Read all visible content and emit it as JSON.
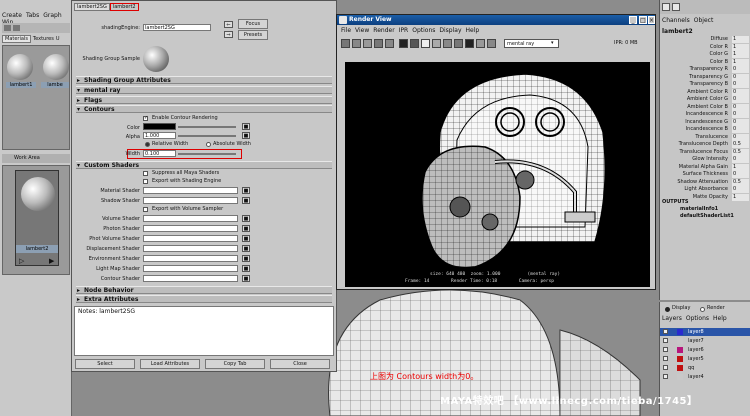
{
  "hypershade": {
    "menu": [
      "Create",
      "Tabs",
      "Graph",
      "Win"
    ],
    "tabs": [
      "Materials",
      "Textures",
      "U"
    ],
    "swatches": [
      "lambert1",
      "lambe"
    ],
    "work_area_label": "Work Area",
    "work_swatch": "lambert2"
  },
  "attr_editor": {
    "tabs": [
      "lambert2SG",
      "lambert2"
    ],
    "shading_engine_label": "shadingEngine:",
    "shading_engine_value": "lambert2SG",
    "focus_btn": "Focus",
    "presets_btn": "Presets",
    "sample_label": "Shading Group Sample",
    "sections": {
      "sg_attrs": "Shading Group Attributes",
      "mental_ray": "mental ray",
      "flags": "Flags",
      "contours": "Contours",
      "custom": "Custom Shaders",
      "node_behavior": "Node Behavior",
      "extra": "Extra Attributes"
    },
    "contours": {
      "enable": "Enable Contour Rendering",
      "color_label": "Color",
      "alpha_label": "Alpha",
      "alpha_value": "1.000",
      "relative": "Relative Width",
      "absolute": "Absolute Width",
      "width_label": "Width",
      "width_value": "0.100"
    },
    "custom": {
      "suppress": "Suppress all Maya Shaders",
      "export_engine": "Export with Shading Engine",
      "material": "Material Shader",
      "shadow": "Shadow Shader",
      "export_volume": "Export with Volume Sampler",
      "volume": "Volume Shader",
      "photon": "Photon Shader",
      "photon_vol": "Phot Volume Shader",
      "displacement": "Displacement Shader",
      "environment": "Environment Shader",
      "light_map": "Light Map Shader",
      "contour": "Contour Shader"
    },
    "notes": "Notes: lambert2SG",
    "buttons": [
      "Select",
      "Load Attributes",
      "Copy Tab",
      "Close"
    ]
  },
  "render_view": {
    "title": "Render View",
    "menu": [
      "File",
      "View",
      "Render",
      "IPR",
      "Options",
      "Display",
      "Help"
    ],
    "renderer": "mental ray",
    "ipr_label": "IPR: 0 MB",
    "info1": "size: 640 480  zoom: 1.000          (mental ray)",
    "info2": "Frame: 14        Render Time: 0:18        Camera: persp"
  },
  "channel_box": {
    "menu": [
      "Channels",
      "Object"
    ],
    "node": "lambert2",
    "rows": [
      [
        "Diffuse",
        "1"
      ],
      [
        "Color R",
        "1"
      ],
      [
        "Color G",
        "1"
      ],
      [
        "Color B",
        "1"
      ],
      [
        "Transparency R",
        "0"
      ],
      [
        "Transparency G",
        "0"
      ],
      [
        "Transparency B",
        "0"
      ],
      [
        "Ambient Color R",
        "0"
      ],
      [
        "Ambient Color G",
        "0"
      ],
      [
        "Ambient Color B",
        "0"
      ],
      [
        "Incandescence R",
        "0"
      ],
      [
        "Incandescence G",
        "0"
      ],
      [
        "Incandescence B",
        "0"
      ],
      [
        "Translucence",
        "0"
      ],
      [
        "Translucence Depth",
        "0.5"
      ],
      [
        "Translucence Focus",
        "0.5"
      ],
      [
        "Glow Intensity",
        "0"
      ],
      [
        "Material Alpha Gain",
        "1"
      ],
      [
        "Surface Thickness",
        "0"
      ],
      [
        "Shadow Attenuation",
        "0.5"
      ],
      [
        "Light Absorbance",
        "0"
      ],
      [
        "Matte Opacity",
        "1"
      ]
    ],
    "outputs_label": "OUTPUTS",
    "outputs": [
      "materialInfo1",
      "defaultShaderList1"
    ]
  },
  "layers": {
    "display": "Display",
    "render": "Render",
    "menu": [
      "Layers",
      "Options",
      "Help"
    ],
    "items": [
      {
        "name": "layer8",
        "color": "#2a2ad0"
      },
      {
        "name": "layer7",
        "color": "#c8c8c8"
      },
      {
        "name": "layer6",
        "color": "#b7157b"
      },
      {
        "name": "layer5",
        "color": "#c01010"
      },
      {
        "name": "qq",
        "color": "#c01010"
      },
      {
        "name": "layer4",
        "color": "#c8c8c8"
      }
    ]
  },
  "caption": "上图为 Contours  width为0。",
  "watermark": "MAYA特效吧 【www.linecg.com/tieba/1745】"
}
